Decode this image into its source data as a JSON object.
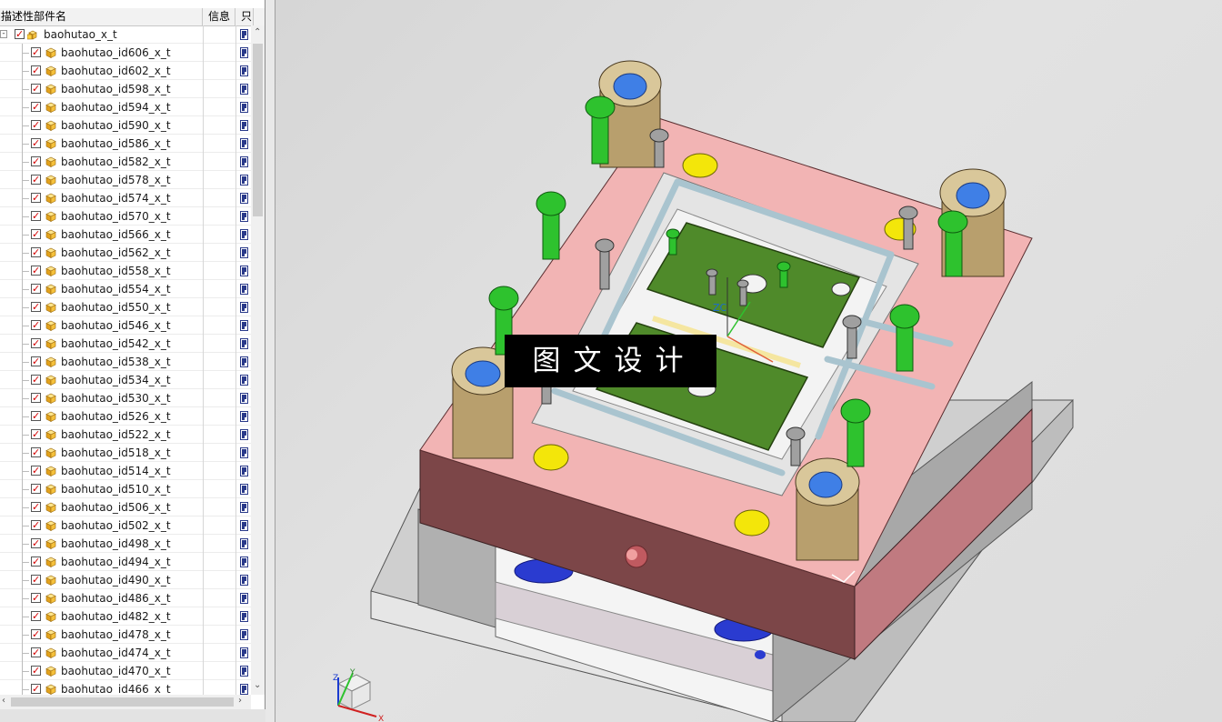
{
  "navigator": {
    "columns": {
      "name": "描述性部件名",
      "info": "信息",
      "readonly": "只"
    },
    "root": {
      "label": "baohutao_x_t",
      "checked": true
    },
    "parts": [
      "baohutao_id606_x_t",
      "baohutao_id602_x_t",
      "baohutao_id598_x_t",
      "baohutao_id594_x_t",
      "baohutao_id590_x_t",
      "baohutao_id586_x_t",
      "baohutao_id582_x_t",
      "baohutao_id578_x_t",
      "baohutao_id574_x_t",
      "baohutao_id570_x_t",
      "baohutao_id566_x_t",
      "baohutao_id562_x_t",
      "baohutao_id558_x_t",
      "baohutao_id554_x_t",
      "baohutao_id550_x_t",
      "baohutao_id546_x_t",
      "baohutao_id542_x_t",
      "baohutao_id538_x_t",
      "baohutao_id534_x_t",
      "baohutao_id530_x_t",
      "baohutao_id526_x_t",
      "baohutao_id522_x_t",
      "baohutao_id518_x_t",
      "baohutao_id514_x_t",
      "baohutao_id510_x_t",
      "baohutao_id506_x_t",
      "baohutao_id502_x_t",
      "baohutao_id498_x_t",
      "baohutao_id494_x_t",
      "baohutao_id490_x_t",
      "baohutao_id486_x_t",
      "baohutao_id482_x_t",
      "baohutao_id478_x_t",
      "baohutao_id474_x_t",
      "baohutao_id470_x_t",
      "baohutao_id466_x_t"
    ]
  },
  "viewport": {
    "watermark": "图文设计",
    "wcs_label": "ZC",
    "triad": {
      "z": "Z",
      "y": "Y",
      "x": "X"
    }
  },
  "colors": {
    "plate_top": "#f2b4b4",
    "plate_side": "#7c4648",
    "bushing": "#c9b58a",
    "screw_green": "#2ec22e",
    "insert_green": "#4f8a2a",
    "dot_yellow": "#f3e60a",
    "bushing_blue": "#3f7fe6",
    "spring_blue": "#2a3bd0"
  },
  "icons": [
    "checkbox-checked-icon",
    "assembly-icon",
    "part-cube-icon",
    "readonly-lock-icon",
    "scroll-up-icon",
    "scroll-down-icon",
    "scroll-left-icon",
    "scroll-right-icon",
    "wcs-triad-icon"
  ]
}
